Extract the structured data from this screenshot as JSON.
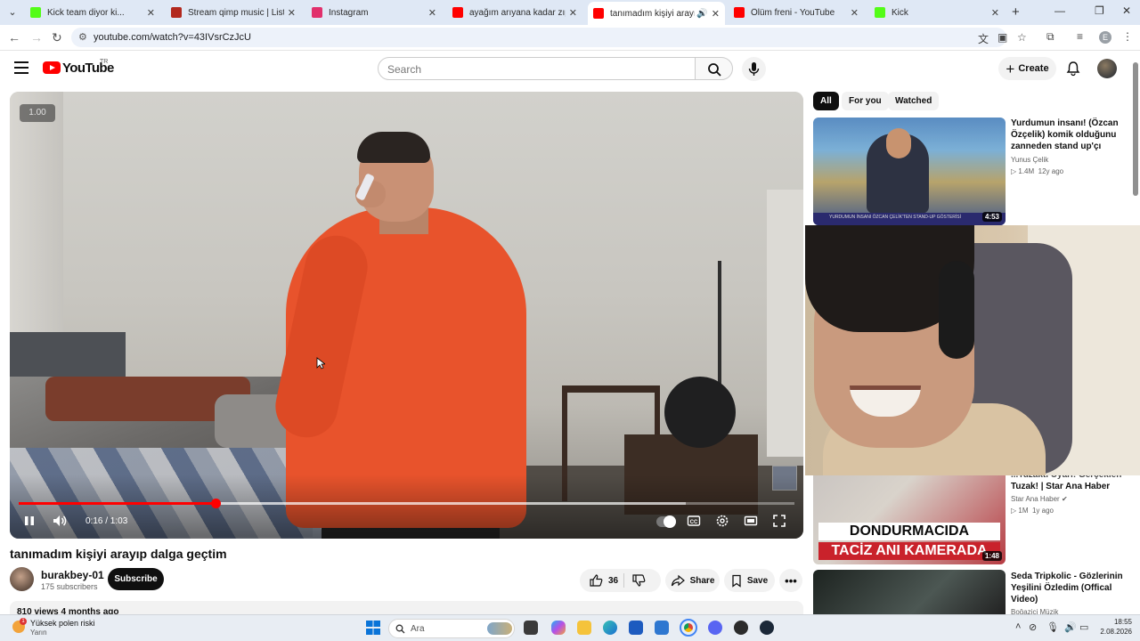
{
  "browser": {
    "tabs": [
      {
        "title": "Kick team diyor ki...",
        "favicon_color": "#53fc18"
      },
      {
        "title": "Stream qimp music | Listen to s",
        "favicon_color": "#b2281e"
      },
      {
        "title": "Instagram",
        "favicon_color": "#e1306c"
      },
      {
        "title": "ayağım arıyana kadar zıpladım",
        "favicon_color": "#ff0000"
      },
      {
        "title": "tanımadım kişiyi arayıp dalga",
        "favicon_color": "#ff0000",
        "active": true
      },
      {
        "title": "Ölüm freni - YouTube",
        "favicon_color": "#ff0000"
      },
      {
        "title": "Kick",
        "favicon_color": "#53fc18"
      }
    ],
    "url": "youtube.com/watch?v=43IVsrCzJcU",
    "profile_initial": "E"
  },
  "youtube": {
    "logo_text": "YouTube",
    "country": "TR",
    "search_placeholder": "Search",
    "create_label": "Create"
  },
  "player": {
    "speed_badge": "1.00",
    "current_time": "0:16",
    "duration": "1:03",
    "time_text": "0:16 / 1:03",
    "progress_fraction": 0.254,
    "buffered_fraction": 0.86
  },
  "video": {
    "title": "tanımadım kişiyi arayıp dalga geçtim",
    "channel": "burakbey-01",
    "subscribers": "175 subscribers",
    "subscribe_label": "Subscribe",
    "likes": "36",
    "share_label": "Share",
    "save_label": "Save",
    "meta": "810 views  4 months ago"
  },
  "sidebar": {
    "chips": [
      "All",
      "For you",
      "Watched"
    ],
    "videos": [
      {
        "title": "Yurdumun insanı! (Özcan Özçelik) komik olduğunu zanneden stand up'çı",
        "channel": "Yunus Çelik",
        "views": "1.4M",
        "age": "12y ago",
        "duration": "4:53",
        "banner": "YURDUMUN İNSANI ÖZCAN ÇELİK'TEN STAND-UP GÖSTERİSİ"
      },
      {
        "title": "Tuzak! | Star Ana Haber",
        "title_partial": "...Tuzaktı Uyarı! Gerçeklen",
        "channel": "Star Ana Haber",
        "views": "1M",
        "age": "1y ago",
        "duration": "1:48",
        "caption1": "DONDURMACIDA",
        "caption2": "TACİZ ANI KAMERADA"
      },
      {
        "title": "Seda Tripkolic - Gözlerinin Yeşilini Özledim (Offical Video)",
        "channel": "Boğaziçi Müzik"
      }
    ]
  },
  "taskbar": {
    "weather_title": "Yüksek polen riski",
    "weather_sub": "Yarın",
    "weather_badge": "1",
    "search_placeholder": "Ara",
    "time": "18:55",
    "date": "2.08.2026"
  }
}
